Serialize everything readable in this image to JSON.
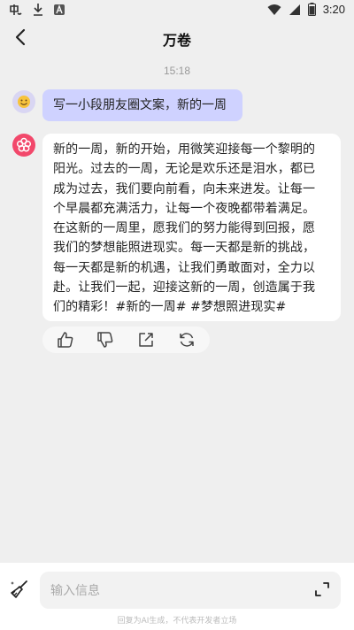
{
  "statusbar": {
    "time": "3:20",
    "left_icons": [
      "app-logo-icon",
      "download-icon",
      "font-icon"
    ],
    "right_icons": [
      "wifi-icon",
      "signal-icon",
      "battery-icon"
    ]
  },
  "header": {
    "title": "万卷",
    "back_icon": "chevron-left-icon"
  },
  "chat": {
    "timestamp": "15:18",
    "user_message": "写一小段朋友圈文案，新的一周",
    "ai_message": "新的一周，新的开始，用微笑迎接每一个黎明的阳光。过去的一周，无论是欢乐还是泪水，都已成为过去，我们要向前看，向未来进发。让每一个早晨都充满活力，让每一个夜晚都带着满足。在这新的一周里，愿我们的努力能得到回报，愿我们的梦想能照进现实。每一天都是新的挑战，每一天都是新的机遇，让我们勇敢面对，全力以赴。让我们一起，迎接这新的一周，创造属于我们的精彩！#新的一周# #梦想照进现实#",
    "ai_lines": [
      "新的一周，新的开始，用微笑迎接每一个黎明的",
      "阳光。过去的一周，无论是欢乐还是泪水，都已",
      "成为过去，我们要向前看，向未来进发。让每一",
      "个早晨都充满活力，让每一个夜晚都带着满足。",
      "在这新的一周里，愿我们的努力能得到回报，愿",
      "我们的梦想能照进现实。每一天都是新的挑战，",
      "每一天都是新的机遇，让我们勇敢面对，全力以",
      "赴。让我们一起，迎接这新的一周，创造属于我",
      "们的精彩！#新的一周# #梦想照进现实#"
    ],
    "actions": [
      "thumbs-up-icon",
      "thumbs-down-icon",
      "share-icon",
      "regenerate-icon"
    ]
  },
  "composer": {
    "placeholder": "输入信息",
    "disclaimer": "回复为AI生成，不代表开发者立场"
  },
  "colors": {
    "background": "#efefef",
    "user_bubble": "#cfd2ff",
    "ai_bubble": "#ffffff",
    "ai_avatar": "#f2486b"
  }
}
